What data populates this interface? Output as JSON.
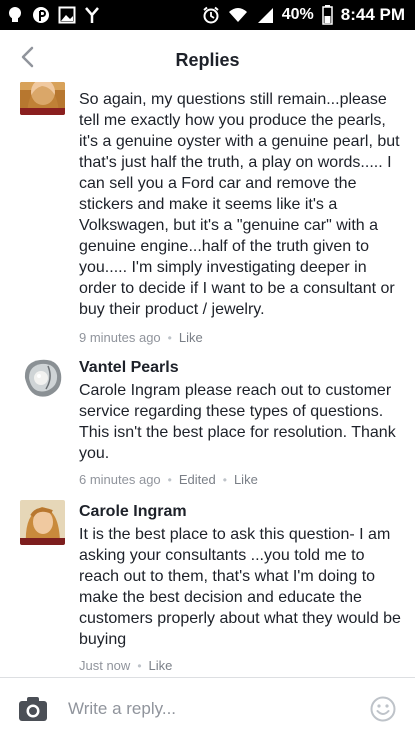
{
  "status_bar": {
    "battery_percent": "40%",
    "time": "8:44 PM",
    "icons": [
      "notification-icon",
      "pinterest-icon",
      "gallery-icon",
      "wifi-signal-icon",
      "alarm-icon",
      "wifi-icon",
      "cell-signal-icon",
      "battery-icon"
    ]
  },
  "header": {
    "title": "Replies",
    "back_icon": "back-chevron-icon"
  },
  "comments": [
    {
      "author": "",
      "text": "So again, my questions still remain...please tell me exactly how you produce the pearls, it's a genuine oyster with a genuine pearl, but that's just half the truth, a play on words..... I can sell you a Ford car and remove the stickers and make it seems like it's a Volkswagen, but it's a \"genuine car\" with a genuine engine...half of the truth given to you..... I'm simply investigating deeper in order to decide if I want to be a consultant or buy their product / jewelry.",
      "time": "9 minutes ago",
      "like": "Like"
    },
    {
      "author": "Vantel Pearls",
      "text": "Carole Ingram please reach out to customer service regarding these types of questions. This isn't the best place for resolution. Thank you.",
      "time": "6 minutes ago",
      "edited": "Edited",
      "like": "Like"
    },
    {
      "author": "Carole Ingram",
      "text": "It is the best place to ask this question- I am asking your consultants ...you told me to reach out to them, that's what I'm doing to make the best decision and educate the customers properly about what they would be buying",
      "time": "Just now",
      "like": "Like"
    }
  ],
  "composer": {
    "placeholder": "Write a reply...",
    "value": "",
    "camera_icon": "camera-icon",
    "emoji_icon": "emoji-icon"
  },
  "colors": {
    "status_bar_bg": "#000000",
    "text": "#1d2129",
    "meta_text": "#90949c",
    "divider": "#dddfe2"
  }
}
